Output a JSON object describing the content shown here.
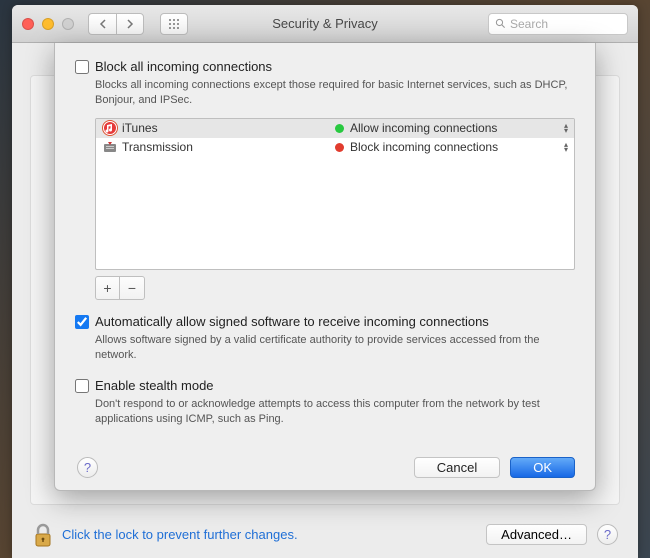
{
  "window_title": "Security & Privacy",
  "search": {
    "placeholder": "Search"
  },
  "block_all": {
    "checked": false,
    "label": "Block all incoming connections",
    "desc": "Blocks all incoming connections except those required for basic Internet services,  such as DHCP, Bonjour, and IPSec."
  },
  "apps": [
    {
      "name": "iTunes",
      "icon": "itunes",
      "status_color": "green",
      "status_text": "Allow incoming connections"
    },
    {
      "name": "Transmission",
      "icon": "transmission",
      "status_color": "red",
      "status_text": "Block incoming connections"
    }
  ],
  "auto_allow": {
    "checked": true,
    "label": "Automatically allow signed software to receive incoming connections",
    "desc": "Allows software signed by a valid certificate authority to provide services accessed from the network."
  },
  "stealth": {
    "checked": false,
    "label": "Enable stealth mode",
    "desc": "Don't respond to or acknowledge attempts to access this computer from the network by test applications using ICMP, such as Ping."
  },
  "buttons": {
    "cancel": "Cancel",
    "ok": "OK",
    "advanced": "Advanced…"
  },
  "lock_text": "Click the lock to prevent further changes.",
  "add": "+",
  "remove": "−",
  "help": "?"
}
